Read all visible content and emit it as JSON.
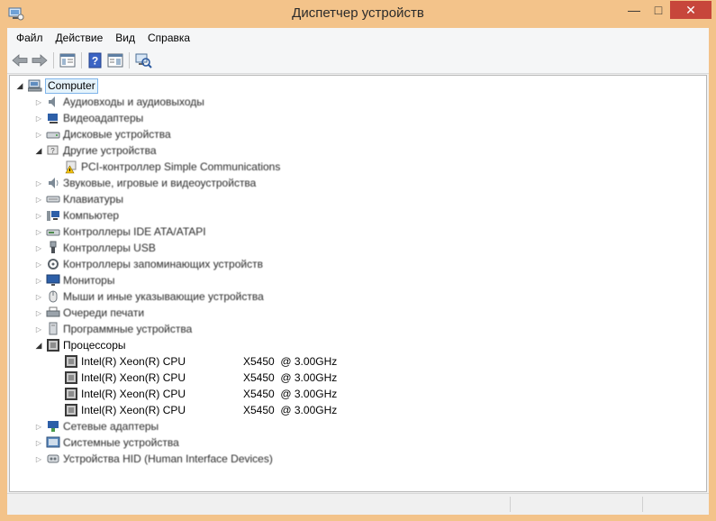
{
  "window": {
    "title": "Диспетчер устройств",
    "controls": {
      "minimize": "—",
      "maximize": "□",
      "close": "✕"
    },
    "accent": "#f3c38a"
  },
  "menu": [
    "Файл",
    "Действие",
    "Вид",
    "Справка"
  ],
  "toolbar": [
    {
      "name": "back-button",
      "icon": "arrow-left-icon"
    },
    {
      "name": "forward-button",
      "icon": "arrow-right-icon"
    },
    {
      "name": "show-hide-console-tree-button",
      "icon": "console-tree-icon"
    },
    {
      "name": "help-button",
      "icon": "help-icon"
    },
    {
      "name": "properties-view-button",
      "icon": "properties-icon"
    },
    {
      "name": "scan-hardware-button",
      "icon": "scan-hardware-icon"
    }
  ],
  "tree": {
    "root": "Computer",
    "items": [
      {
        "label": "Аудиовходы и аудиовыходы",
        "icon": "audio-icon",
        "expanded": false
      },
      {
        "label": "Видеоадаптеры",
        "icon": "display-adapter-icon",
        "expanded": false
      },
      {
        "label": "Дисковые устройства",
        "icon": "disk-icon",
        "expanded": false
      },
      {
        "label": "Другие устройства",
        "icon": "other-devices-icon",
        "expanded": true,
        "children": [
          {
            "label": "PCI-контроллер Simple Communications",
            "icon": "warning-device-icon"
          }
        ]
      },
      {
        "label": "Звуковые, игровые и видеоустройства",
        "icon": "sound-icon",
        "expanded": false
      },
      {
        "label": "Клавиатуры",
        "icon": "keyboard-icon",
        "expanded": false
      },
      {
        "label": "Компьютер",
        "icon": "computer-icon",
        "expanded": false
      },
      {
        "label": "Контроллеры IDE ATA/ATAPI",
        "icon": "ide-icon",
        "expanded": false
      },
      {
        "label": "Контроллеры USB",
        "icon": "usb-icon",
        "expanded": false
      },
      {
        "label": "Контроллеры запоминающих устройств",
        "icon": "storage-controller-icon",
        "expanded": false
      },
      {
        "label": "Мониторы",
        "icon": "monitor-icon",
        "expanded": false
      },
      {
        "label": "Мыши и иные указывающие устройства",
        "icon": "mouse-icon",
        "expanded": false
      },
      {
        "label": "Очереди печати",
        "icon": "printer-icon",
        "expanded": false
      },
      {
        "label": "Программные устройства",
        "icon": "software-device-icon",
        "expanded": false
      },
      {
        "label": "Процессоры",
        "icon": "processor-icon",
        "expanded": true,
        "children": [
          {
            "label": "Intel(R) Xeon(R) CPU",
            "model": "X5450  @ 3.00GHz",
            "icon": "processor-icon"
          },
          {
            "label": "Intel(R) Xeon(R) CPU",
            "model": "X5450  @ 3.00GHz",
            "icon": "processor-icon"
          },
          {
            "label": "Intel(R) Xeon(R) CPU",
            "model": "X5450  @ 3.00GHz",
            "icon": "processor-icon"
          },
          {
            "label": "Intel(R) Xeon(R) CPU",
            "model": "X5450  @ 3.00GHz",
            "icon": "processor-icon"
          }
        ]
      },
      {
        "label": "Сетевые адаптеры",
        "icon": "network-icon",
        "expanded": false
      },
      {
        "label": "Системные устройства",
        "icon": "system-devices-icon",
        "expanded": false
      },
      {
        "label": "Устройства HID (Human Interface Devices)",
        "icon": "hid-icon",
        "expanded": false
      }
    ]
  }
}
